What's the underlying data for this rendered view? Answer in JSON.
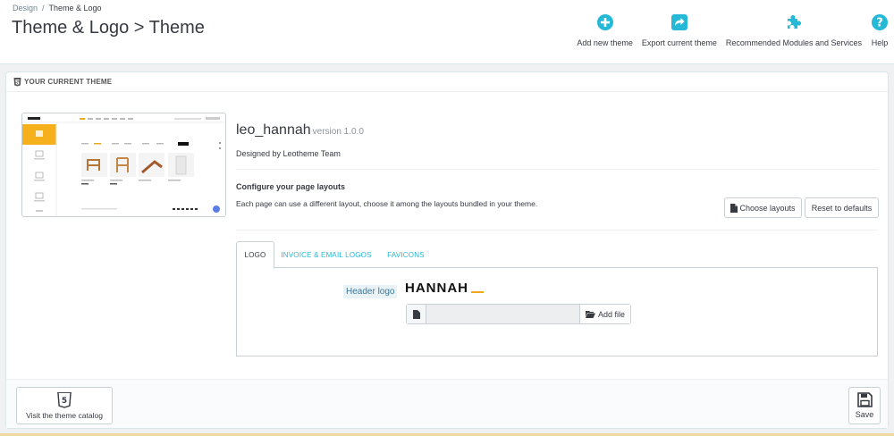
{
  "breadcrumb": {
    "parent": "Design",
    "separator": "/",
    "current": "Theme & Logo"
  },
  "page_title": "Theme & Logo > Theme",
  "toolbar": {
    "add_theme": "Add new theme",
    "export_theme": "Export current theme",
    "modules": "Recommended Modules and Services",
    "help": "Help"
  },
  "colors": {
    "accent": "#25b9d7",
    "logo_bar": "#f0a81a",
    "text": "#363a41"
  },
  "panel": {
    "heading": "YOUR CURRENT THEME"
  },
  "theme": {
    "name": "leo_hannah",
    "version": "version 1.0.0",
    "designer": "Designed by Leotheme Team"
  },
  "layouts": {
    "title": "Configure your page layouts",
    "description": "Each page can use a different layout, choose it among the layouts bundled in your theme.",
    "choose_label": "Choose layouts",
    "reset_label": "Reset to defaults"
  },
  "tabs": [
    {
      "label": "LOGO",
      "active": true
    },
    {
      "label": "INVOICE & EMAIL LOGOS",
      "active": false
    },
    {
      "label": "FAVICONS",
      "active": false
    }
  ],
  "logo_tab": {
    "header_logo_label": "Header logo",
    "logo_text": "HANNAH",
    "add_file_label": "Add file"
  },
  "footer": {
    "catalog_label": "Visit the theme catalog",
    "save_label": "Save"
  }
}
